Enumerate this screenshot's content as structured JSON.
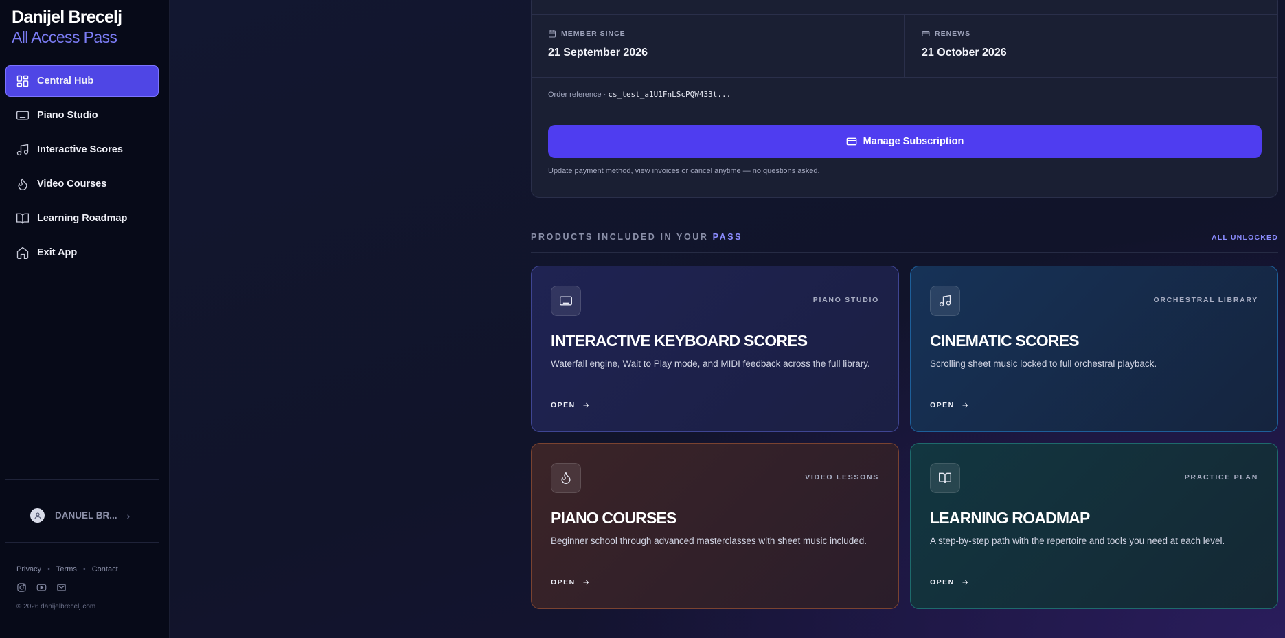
{
  "brand": {
    "name": "Danijel Brecelj",
    "subtitle": "All Access Pass"
  },
  "nav": [
    {
      "label": "Central Hub",
      "icon": "dashboard-icon",
      "active": true
    },
    {
      "label": "Piano Studio",
      "icon": "keyboard-icon",
      "active": false
    },
    {
      "label": "Interactive Scores",
      "icon": "music-note-icon",
      "active": false
    },
    {
      "label": "Video Courses",
      "icon": "flame-icon",
      "active": false
    },
    {
      "label": "Learning Roadmap",
      "icon": "book-icon",
      "active": false
    },
    {
      "label": "Exit App",
      "icon": "home-icon",
      "active": false
    }
  ],
  "user": {
    "name": "DANUEL BR...",
    "chevron": "›"
  },
  "footer": {
    "links": [
      "Privacy",
      "Terms",
      "Contact"
    ],
    "separator": "•",
    "socials": [
      "instagram-icon",
      "youtube-icon",
      "mail-icon"
    ],
    "copyright": "© 2026 danijelbrecelj.com"
  },
  "subscription": {
    "member_since_label": "MEMBER SINCE",
    "member_since_value": "21 September 2026",
    "renews_label": "RENEWS",
    "renews_value": "21 October 2026",
    "order_ref_label": "Order reference · ",
    "order_ref_value": "cs_test_a1U1FnLScPQW433t...",
    "manage_label": "Manage Subscription",
    "manage_note": "Update payment method, view invoices or cancel anytime — no questions asked."
  },
  "products": {
    "title_prefix": "PRODUCTS INCLUDED IN YOUR ",
    "title_accent": "PASS",
    "status": "ALL UNLOCKED",
    "open_label": "OPEN",
    "cards": [
      {
        "tag": "PIANO STUDIO",
        "title": "INTERACTIVE KEYBOARD SCORES",
        "desc": "Waterfall engine, Wait to Play mode, and MIDI feedback across the full library.",
        "icon": "keyboard-icon"
      },
      {
        "tag": "ORCHESTRAL LIBRARY",
        "title": "CINEMATIC SCORES",
        "desc": "Scrolling sheet music locked to full orchestral playback.",
        "icon": "music-note-icon"
      },
      {
        "tag": "VIDEO LESSONS",
        "title": "PIANO COURSES",
        "desc": "Beginner school through advanced masterclasses with sheet music included.",
        "icon": "flame-icon"
      },
      {
        "tag": "PRACTICE PLAN",
        "title": "LEARNING ROADMAP",
        "desc": "A step-by-step path with the repertoire and tools you need at each level.",
        "icon": "book-icon"
      }
    ]
  },
  "colors": {
    "accent": "#4f46e5",
    "accent_text": "#8b8cff",
    "sidebar_bg": "#070a18"
  }
}
